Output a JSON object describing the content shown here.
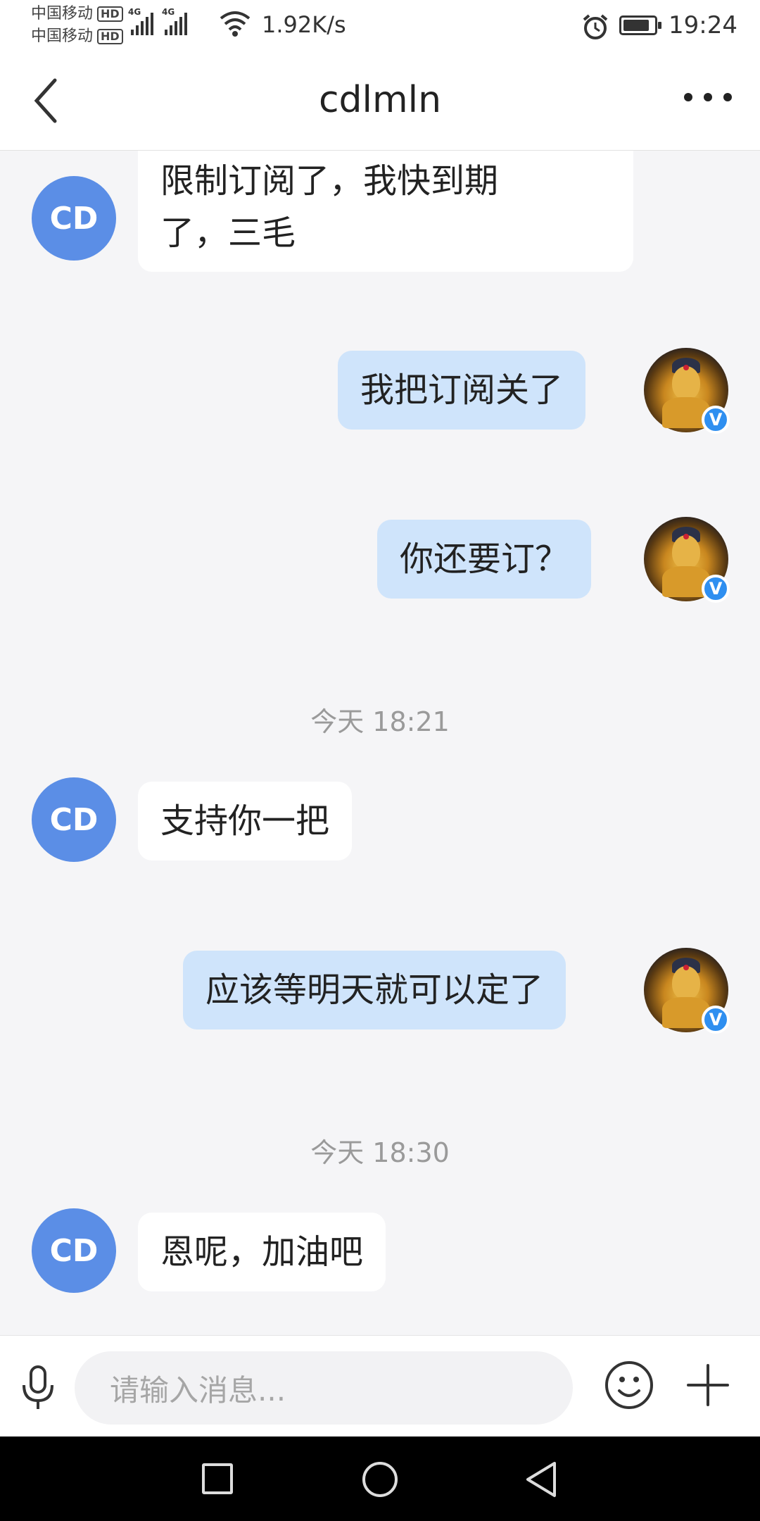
{
  "status_bar": {
    "carrier1": "中国移动",
    "carrier2": "中国移动",
    "hd_badge": "HD",
    "network": "4G",
    "net_speed": "1.92K/s",
    "time": "19:24"
  },
  "header": {
    "title": "cdlmln"
  },
  "messages": [
    {
      "type": "in",
      "avatar_text": "CD",
      "text_line1": "限制订阅了，我快到期",
      "text_line2": "了，三毛"
    },
    {
      "type": "out",
      "text": "我把订阅关了",
      "badge": "V"
    },
    {
      "type": "out",
      "text": "你还要订？",
      "badge": "V"
    },
    {
      "type": "time",
      "text": "今天 18:21"
    },
    {
      "type": "in",
      "avatar_text": "CD",
      "text": "支持你一把"
    },
    {
      "type": "out",
      "text": "应该等明天就可以定了",
      "badge": "V"
    },
    {
      "type": "time",
      "text": "今天 18:30"
    },
    {
      "type": "in",
      "avatar_text": "CD",
      "text": "恩呢，加油吧"
    }
  ],
  "input_bar": {
    "placeholder": "请输入消息..."
  },
  "colors": {
    "avatar_cd": "#5b8ee6",
    "outgoing_bubble": "#cfe4fb",
    "verified_badge": "#2f8ff0"
  },
  "icons": [
    "mic-icon",
    "emoji-icon",
    "plus-icon",
    "back-arrow-icon",
    "more-icon",
    "wifi-icon",
    "alarm-icon",
    "battery-icon"
  ]
}
